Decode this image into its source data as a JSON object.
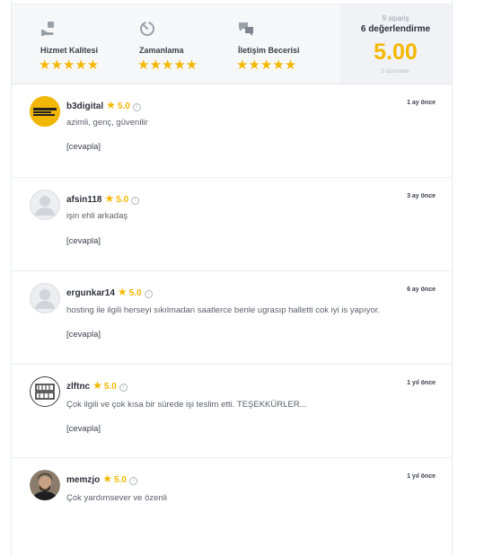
{
  "summary": {
    "criteria": [
      {
        "label": "Hizmet Kalitesi",
        "icon": "hand-box-icon",
        "stars": "★★★★★"
      },
      {
        "label": "Zamanlama",
        "icon": "timer-icon",
        "stars": "★★★★★"
      },
      {
        "label": "İletişim Becerisi",
        "icon": "chat-bubbles-icon",
        "stars": "★★★★★"
      }
    ],
    "orders": "9 sipariş",
    "ratings": "6 değerlendirme",
    "score": "5.00",
    "out_of": "5 üzerinden",
    "accent_color": "#f5b800"
  },
  "reviews": [
    {
      "user": "b3digital",
      "star": "★",
      "score": "5.0",
      "info": "i",
      "time": "1 ay önce",
      "text": "azimli, genç, güvenilir",
      "reply": "[cevapla]",
      "avatar": "b3digital-logo"
    },
    {
      "user": "afsin118",
      "star": "★",
      "score": "5.0",
      "info": "i",
      "time": "3 ay önce",
      "text": "işin ehli arkadaş",
      "reply": "[cevapla]",
      "avatar": "default-avatar"
    },
    {
      "user": "ergunkar14",
      "star": "★",
      "score": "5.0",
      "info": "i",
      "time": "6 ay önce",
      "text": "hosting ile ilgili herseyi sıkılmadan saatlerce benle ugrasıp halletti cok iyi is yapıyor.",
      "reply": "[cevapla]",
      "avatar": "default-avatar"
    },
    {
      "user": "zlftnc",
      "star": "★",
      "score": "5.0",
      "info": "i",
      "time": "1 yıl önce",
      "text": "Çok ilgili ve çok kısa bir sürede işi teslim etti. TEŞEKKÜRLER...",
      "reply": "[cevapla]",
      "avatar": "zlftnc-logo"
    },
    {
      "user": "memzjo",
      "star": "★",
      "score": "5.0",
      "info": "i",
      "time": "1 yıl önce",
      "text": "Çok yardımsever ve özenli",
      "reply": "[cevapla]",
      "avatar": "photo-avatar"
    }
  ]
}
